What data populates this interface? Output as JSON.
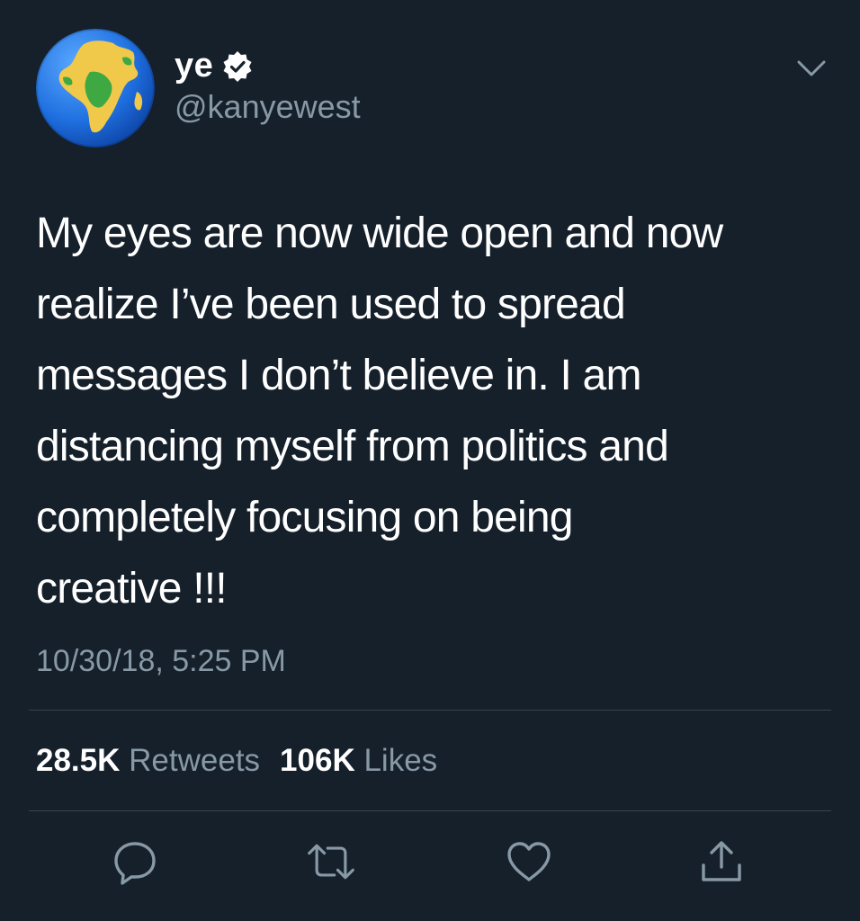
{
  "user": {
    "display_name": "ye",
    "handle": "@kanyewest",
    "avatar_icon": "globe-earth-africa-icon",
    "verified": true
  },
  "tweet": {
    "text": "My eyes are now wide open and now\nrealize I’ve been used to spread\nmessages I don’t believe in. I am\ndistancing myself from politics and\ncompletely focusing on being\ncreative !!!",
    "timestamp": "10/30/18, 5:25 PM"
  },
  "stats": {
    "retweets_count": "28.5K",
    "retweets_label": "Retweets",
    "likes_count": "106K",
    "likes_label": "Likes"
  },
  "actions": [
    "reply-icon",
    "retweet-icon",
    "like-icon",
    "share-icon"
  ],
  "colors": {
    "background": "#15202b",
    "secondary_text": "#8899a6",
    "divider": "#38444d",
    "primary_text": "#ffffff"
  }
}
